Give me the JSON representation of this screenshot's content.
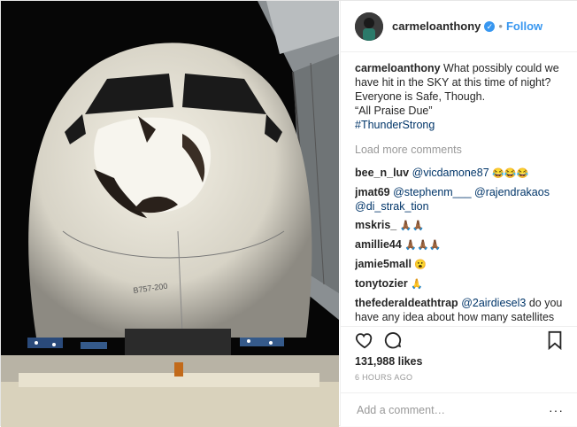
{
  "post": {
    "username": "carmeloanthony",
    "follow_label": "Follow",
    "dot": "•",
    "photo_label": "B757-200",
    "caption": {
      "user": "carmeloanthony",
      "text": "What possibly could we have hit in the SKY at this time of night? Everyone is Safe, Though.",
      "line2": "“All Praise Due”",
      "hashtag": "#ThunderStrong"
    },
    "load_more": "Load more comments",
    "comments": [
      {
        "user": "bee_n_luv",
        "text": "@vicdamone87",
        "emoji": "😂😂😂"
      },
      {
        "user": "jmat69",
        "text": "@stephenm___ @rajendrakaos @di_strak_tion",
        "emoji": ""
      },
      {
        "user": "mskris_",
        "text": "",
        "emoji": "🙏🏾🙏🏾"
      },
      {
        "user": "amillie44",
        "text": "",
        "emoji": "🙏🏾🙏🏾🙏🏾"
      },
      {
        "user": "jamie5mall",
        "text": "",
        "emoji": "😮"
      },
      {
        "user": "tonytozier",
        "text": "",
        "emoji": "🙏"
      },
      {
        "user": "thefederaldeathtrap",
        "mention": "@2airdiesel3",
        "text": "do you have any idea about how many satellites are in circulation of the earth. Thousands and thousands, many no longer in use, that have just been left up there to fall to earth over"
      }
    ],
    "likes": "131,988 likes",
    "time": "6 HOURS AGO",
    "add_comment_placeholder": "Add a comment…",
    "more_icon": "···",
    "icons": [
      "verified-badge",
      "heart-icon",
      "comment-icon",
      "bookmark-icon",
      "more-options-icon"
    ]
  }
}
